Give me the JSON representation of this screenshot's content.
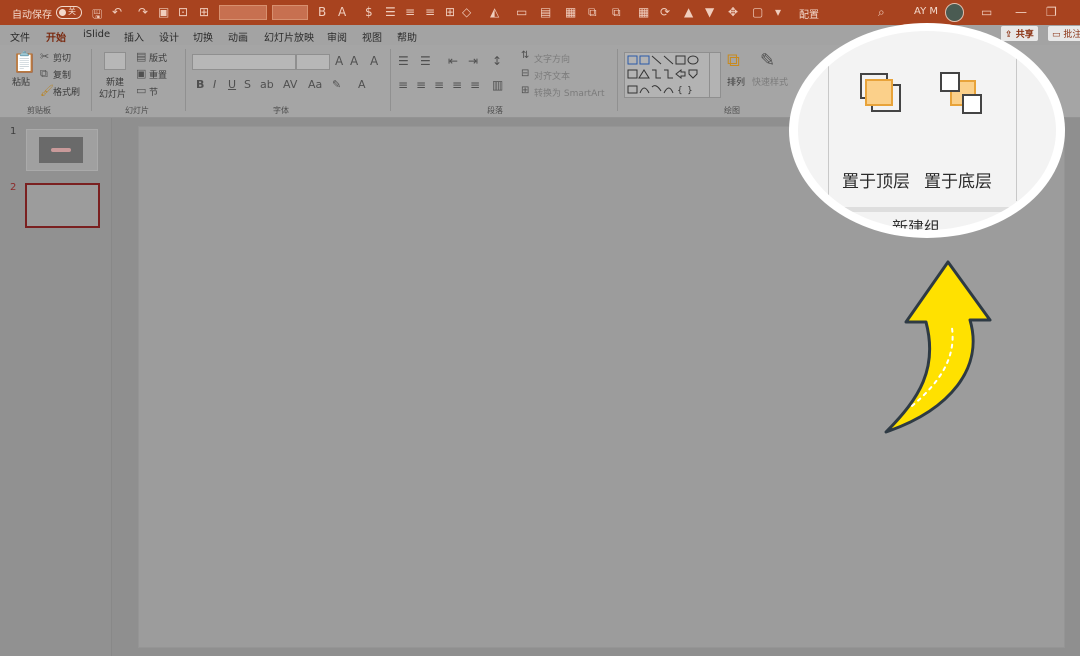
{
  "titlebar": {
    "autosave_label": "自动保存",
    "autosave_state": "关",
    "ribbon_mode_label": "配置",
    "user_initials": "AY M"
  },
  "tabs": [
    "文件",
    "开始",
    "iSlide",
    "插入",
    "设计",
    "切换",
    "动画",
    "幻灯片放映",
    "审阅",
    "视图",
    "帮助"
  ],
  "active_tab": "开始",
  "share_label": "共享",
  "comments_label": "批注",
  "ribbon": {
    "clipboard": {
      "paste": "粘贴",
      "cut": "剪切",
      "copy": "复制",
      "format_painter": "格式刷",
      "group": "剪贴板"
    },
    "slides": {
      "new_slide_line1": "新建",
      "new_slide_line2": "幻灯片",
      "layout": "版式",
      "reset": "重置",
      "section": "节",
      "group": "幻灯片"
    },
    "font": {
      "group": "字体"
    },
    "paragraph": {
      "text_direction": "文字方向",
      "align_text": "对齐文本",
      "convert_smartart": "转换为 SmartArt",
      "group": "段落"
    },
    "drawing": {
      "arrange": "排列",
      "quick_styles": "快速样式",
      "group": "绘图"
    }
  },
  "thumbnails": [
    {
      "number": "1"
    },
    {
      "number": "2"
    }
  ],
  "zoom": {
    "bring_to_front": "置于顶层",
    "send_to_back": "置于底层",
    "group": "新建组"
  },
  "colors": {
    "accent": "#a8431f",
    "arrow": "#ffe100",
    "arrow_outline": "#2e3a44",
    "icon_orange": "#f0a830"
  }
}
